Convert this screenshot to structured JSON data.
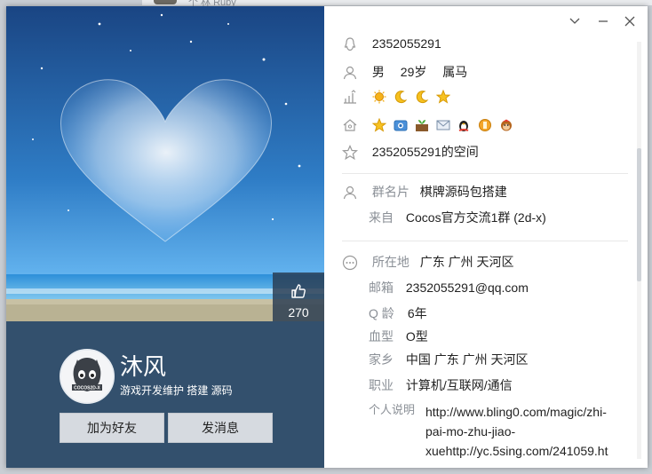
{
  "background_window": {
    "text": "个 林 Ruby"
  },
  "profile": {
    "nickname": "沐风",
    "signature": "游戏开发维护  搭建  源码",
    "likes": "270",
    "avatar_text": "COCOS2D-X",
    "add_friend_label": "加为好友",
    "send_message_label": "发消息"
  },
  "window_controls": {
    "dropdown": "﹀",
    "minimize": "—",
    "close": "✕"
  },
  "info": {
    "qq_number": "2352055291",
    "gender": "男",
    "age": "29岁",
    "zodiac": "属马",
    "qzone": "2352055291的空间",
    "level_icons": [
      "sun-icon",
      "moon-icon",
      "moon-icon",
      "star-icon"
    ],
    "service_icons": [
      "star-icon",
      "camera-icon",
      "farm-icon",
      "mail-icon",
      "penguin-icon",
      "coin-icon",
      "monkey-icon"
    ]
  },
  "group": {
    "card_label": "群名片",
    "card_value": "棋牌源码包搭建",
    "from_label": "来自",
    "from_value": "Cocos官方交流1群 (2d-x)"
  },
  "details": {
    "location_label": "所在地",
    "location_value": "广东 广州 天河区",
    "email_label": "邮箱",
    "email_value": "2352055291@qq.com",
    "qage_label": "Q 龄",
    "qage_value": "6年",
    "blood_label": "血型",
    "blood_value": "O型",
    "hometown_label": "家乡",
    "hometown_value": "中国 广东 广州 天河区",
    "job_label": "职业",
    "job_value": "计算机/互联网/通信",
    "bio_label": "个人说明",
    "bio_line1": "http://www.bling0.com/magic/zhi-",
    "bio_line2": "pai-mo-zhu-jiao-",
    "bio_line3": "xuehttp://yc.5sing.com/241059.ht"
  },
  "colors": {
    "left_panel": "#33506d",
    "sky_top": "#1a4d8a",
    "sky_bottom": "#4a9fe6",
    "button_bg": "#d6dae0"
  }
}
